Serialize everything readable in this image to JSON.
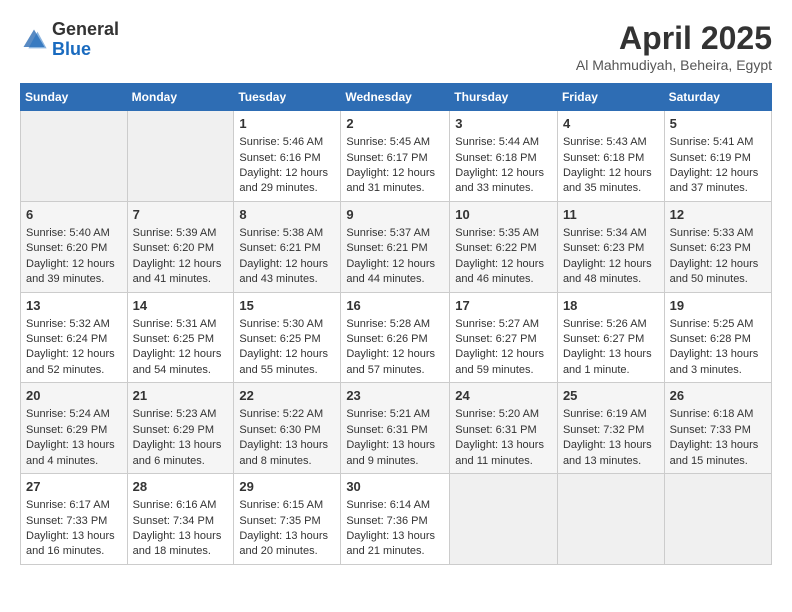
{
  "header": {
    "logo_general": "General",
    "logo_blue": "Blue",
    "month_title": "April 2025",
    "location": "Al Mahmudiyah, Beheira, Egypt"
  },
  "days_of_week": [
    "Sunday",
    "Monday",
    "Tuesday",
    "Wednesday",
    "Thursday",
    "Friday",
    "Saturday"
  ],
  "weeks": [
    [
      {
        "day": "",
        "empty": true
      },
      {
        "day": "",
        "empty": true
      },
      {
        "day": "1",
        "sunrise": "Sunrise: 5:46 AM",
        "sunset": "Sunset: 6:16 PM",
        "daylight": "Daylight: 12 hours and 29 minutes."
      },
      {
        "day": "2",
        "sunrise": "Sunrise: 5:45 AM",
        "sunset": "Sunset: 6:17 PM",
        "daylight": "Daylight: 12 hours and 31 minutes."
      },
      {
        "day": "3",
        "sunrise": "Sunrise: 5:44 AM",
        "sunset": "Sunset: 6:18 PM",
        "daylight": "Daylight: 12 hours and 33 minutes."
      },
      {
        "day": "4",
        "sunrise": "Sunrise: 5:43 AM",
        "sunset": "Sunset: 6:18 PM",
        "daylight": "Daylight: 12 hours and 35 minutes."
      },
      {
        "day": "5",
        "sunrise": "Sunrise: 5:41 AM",
        "sunset": "Sunset: 6:19 PM",
        "daylight": "Daylight: 12 hours and 37 minutes."
      }
    ],
    [
      {
        "day": "6",
        "sunrise": "Sunrise: 5:40 AM",
        "sunset": "Sunset: 6:20 PM",
        "daylight": "Daylight: 12 hours and 39 minutes."
      },
      {
        "day": "7",
        "sunrise": "Sunrise: 5:39 AM",
        "sunset": "Sunset: 6:20 PM",
        "daylight": "Daylight: 12 hours and 41 minutes."
      },
      {
        "day": "8",
        "sunrise": "Sunrise: 5:38 AM",
        "sunset": "Sunset: 6:21 PM",
        "daylight": "Daylight: 12 hours and 43 minutes."
      },
      {
        "day": "9",
        "sunrise": "Sunrise: 5:37 AM",
        "sunset": "Sunset: 6:21 PM",
        "daylight": "Daylight: 12 hours and 44 minutes."
      },
      {
        "day": "10",
        "sunrise": "Sunrise: 5:35 AM",
        "sunset": "Sunset: 6:22 PM",
        "daylight": "Daylight: 12 hours and 46 minutes."
      },
      {
        "day": "11",
        "sunrise": "Sunrise: 5:34 AM",
        "sunset": "Sunset: 6:23 PM",
        "daylight": "Daylight: 12 hours and 48 minutes."
      },
      {
        "day": "12",
        "sunrise": "Sunrise: 5:33 AM",
        "sunset": "Sunset: 6:23 PM",
        "daylight": "Daylight: 12 hours and 50 minutes."
      }
    ],
    [
      {
        "day": "13",
        "sunrise": "Sunrise: 5:32 AM",
        "sunset": "Sunset: 6:24 PM",
        "daylight": "Daylight: 12 hours and 52 minutes."
      },
      {
        "day": "14",
        "sunrise": "Sunrise: 5:31 AM",
        "sunset": "Sunset: 6:25 PM",
        "daylight": "Daylight: 12 hours and 54 minutes."
      },
      {
        "day": "15",
        "sunrise": "Sunrise: 5:30 AM",
        "sunset": "Sunset: 6:25 PM",
        "daylight": "Daylight: 12 hours and 55 minutes."
      },
      {
        "day": "16",
        "sunrise": "Sunrise: 5:28 AM",
        "sunset": "Sunset: 6:26 PM",
        "daylight": "Daylight: 12 hours and 57 minutes."
      },
      {
        "day": "17",
        "sunrise": "Sunrise: 5:27 AM",
        "sunset": "Sunset: 6:27 PM",
        "daylight": "Daylight: 12 hours and 59 minutes."
      },
      {
        "day": "18",
        "sunrise": "Sunrise: 5:26 AM",
        "sunset": "Sunset: 6:27 PM",
        "daylight": "Daylight: 13 hours and 1 minute."
      },
      {
        "day": "19",
        "sunrise": "Sunrise: 5:25 AM",
        "sunset": "Sunset: 6:28 PM",
        "daylight": "Daylight: 13 hours and 3 minutes."
      }
    ],
    [
      {
        "day": "20",
        "sunrise": "Sunrise: 5:24 AM",
        "sunset": "Sunset: 6:29 PM",
        "daylight": "Daylight: 13 hours and 4 minutes."
      },
      {
        "day": "21",
        "sunrise": "Sunrise: 5:23 AM",
        "sunset": "Sunset: 6:29 PM",
        "daylight": "Daylight: 13 hours and 6 minutes."
      },
      {
        "day": "22",
        "sunrise": "Sunrise: 5:22 AM",
        "sunset": "Sunset: 6:30 PM",
        "daylight": "Daylight: 13 hours and 8 minutes."
      },
      {
        "day": "23",
        "sunrise": "Sunrise: 5:21 AM",
        "sunset": "Sunset: 6:31 PM",
        "daylight": "Daylight: 13 hours and 9 minutes."
      },
      {
        "day": "24",
        "sunrise": "Sunrise: 5:20 AM",
        "sunset": "Sunset: 6:31 PM",
        "daylight": "Daylight: 13 hours and 11 minutes."
      },
      {
        "day": "25",
        "sunrise": "Sunrise: 6:19 AM",
        "sunset": "Sunset: 7:32 PM",
        "daylight": "Daylight: 13 hours and 13 minutes."
      },
      {
        "day": "26",
        "sunrise": "Sunrise: 6:18 AM",
        "sunset": "Sunset: 7:33 PM",
        "daylight": "Daylight: 13 hours and 15 minutes."
      }
    ],
    [
      {
        "day": "27",
        "sunrise": "Sunrise: 6:17 AM",
        "sunset": "Sunset: 7:33 PM",
        "daylight": "Daylight: 13 hours and 16 minutes."
      },
      {
        "day": "28",
        "sunrise": "Sunrise: 6:16 AM",
        "sunset": "Sunset: 7:34 PM",
        "daylight": "Daylight: 13 hours and 18 minutes."
      },
      {
        "day": "29",
        "sunrise": "Sunrise: 6:15 AM",
        "sunset": "Sunset: 7:35 PM",
        "daylight": "Daylight: 13 hours and 20 minutes."
      },
      {
        "day": "30",
        "sunrise": "Sunrise: 6:14 AM",
        "sunset": "Sunset: 7:36 PM",
        "daylight": "Daylight: 13 hours and 21 minutes."
      },
      {
        "day": "",
        "empty": true
      },
      {
        "day": "",
        "empty": true
      },
      {
        "day": "",
        "empty": true
      }
    ]
  ]
}
